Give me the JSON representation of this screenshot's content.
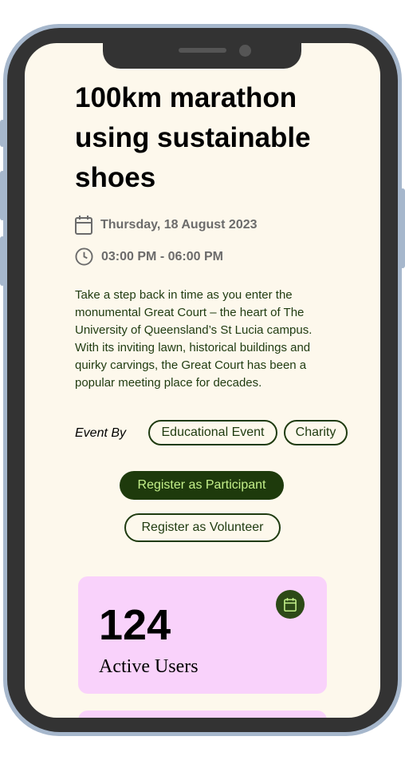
{
  "event": {
    "title": "100km marathon using sustainable shoes",
    "date": "Thursday, 18 August 2023",
    "time": "03:00 PM - 06:00 PM",
    "description": "Take a step back in time as you enter the monumental Great Court – the heart of The University of Queensland’s St Lucia campus. With its inviting lawn, historical buildings and quirky carvings, the Great Court has been a popular meeting place for decades.",
    "event_by_label": "Event By",
    "tags": [
      "Educational Event",
      "Charity"
    ]
  },
  "actions": {
    "register_participant": "Register as Participant",
    "register_volunteer": "Register as Volunteer"
  },
  "stats": {
    "value": "124",
    "label": "Active Users",
    "icon": "calendar-icon"
  },
  "icons": {
    "date": "calendar-icon",
    "time": "clock-icon"
  },
  "colors": {
    "screen_background": "#fdf8ec",
    "primary": "#1e3a0c",
    "primary_text": "#c4f08a",
    "card": "#f9d2fb",
    "frame": "#333333",
    "frame_border": "#a6b7cc"
  }
}
